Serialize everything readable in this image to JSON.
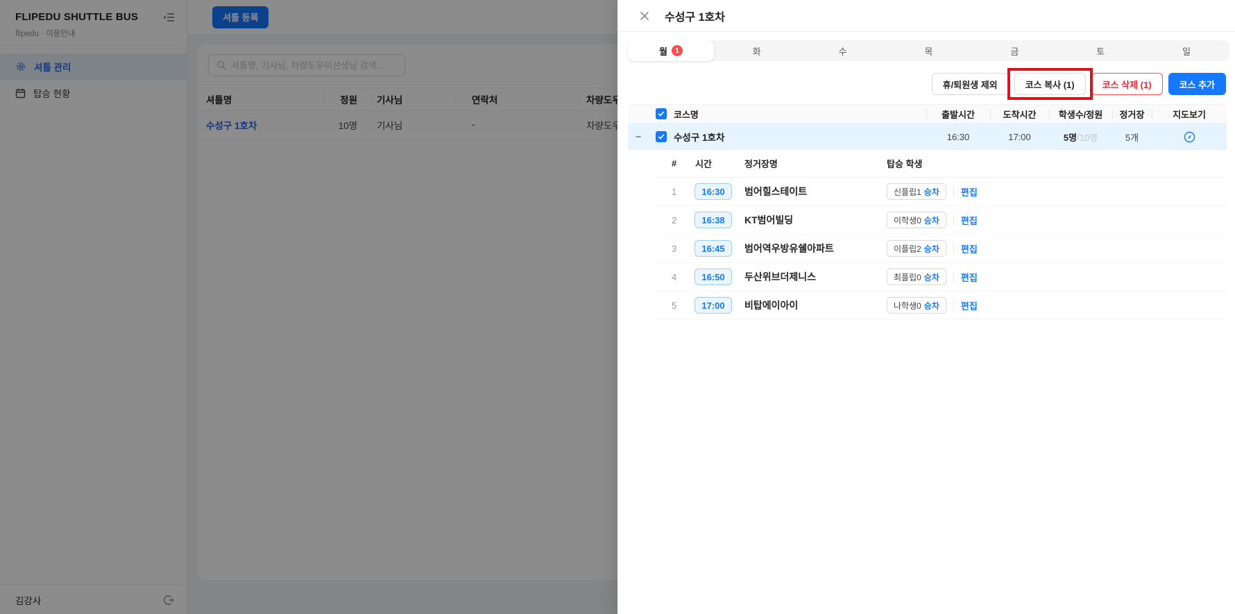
{
  "colors": {
    "primary": "#1677ff",
    "danger": "#f5222d",
    "annotation": "#d8141c",
    "selected_row": "#e6f4ff",
    "badge": "#ff4d4f"
  },
  "sidebar": {
    "title": "FLIPEDU SHUTTLE BUS",
    "subtitle": "flipedu · 이용안내",
    "items": [
      {
        "label": "셔틀 관리"
      },
      {
        "label": "탑승 현황"
      }
    ],
    "user": "김강사"
  },
  "topbar": {
    "register_button": "셔틀 등록"
  },
  "main": {
    "search_placeholder": "셔틀명, 기사님, 차량도우미선생님 검색...",
    "table": {
      "headers": {
        "name": "셔틀명",
        "capacity": "정원",
        "driver": "기사님",
        "contact": "연락처",
        "helper": "차량도우"
      },
      "row": {
        "name": "수성구 1호차",
        "capacity": "10명",
        "driver": "기사님",
        "contact": "-",
        "helper": "차량도우"
      }
    }
  },
  "drawer": {
    "title": "수성구 1호차",
    "tabs": [
      {
        "label": "월",
        "badge": "1"
      },
      {
        "label": "화"
      },
      {
        "label": "수"
      },
      {
        "label": "목"
      },
      {
        "label": "금"
      },
      {
        "label": "토"
      },
      {
        "label": "일"
      }
    ],
    "actions": {
      "exclude": "휴/퇴원생 제외",
      "copy": "코스 복사 (1)",
      "delete": "코스 삭제 (1)",
      "add": "코스 추가"
    },
    "course_table": {
      "headers": {
        "name": "코스명",
        "depart": "출발시간",
        "arrive": "도착시간",
        "students": "학생수/정원",
        "stops": "정거장",
        "map": "지도보기"
      },
      "course": {
        "name": "수성구 1호차",
        "depart": "16:30",
        "arrive": "17:00",
        "students": "5명",
        "students_sep": " / ",
        "capacity": "10명",
        "stops": "5개"
      }
    },
    "stops_table": {
      "headers": {
        "no": "#",
        "time": "시간",
        "name": "정거장명",
        "students": "탑승 학생"
      },
      "board_label": "승차",
      "edit_label": "편집",
      "rows": [
        {
          "no": "1",
          "time": "16:30",
          "name": "범어힐스테이트",
          "student": "신플립1"
        },
        {
          "no": "2",
          "time": "16:38",
          "name": "KT범어빌딩",
          "student": "이학생0"
        },
        {
          "no": "3",
          "time": "16:45",
          "name": "범어역우방유쉘아파트",
          "student": "이플립2"
        },
        {
          "no": "4",
          "time": "16:50",
          "name": "두산위브더제니스",
          "student": "최플립0"
        },
        {
          "no": "5",
          "time": "17:00",
          "name": "비탑에이아이",
          "student": "나학생0"
        }
      ]
    }
  }
}
